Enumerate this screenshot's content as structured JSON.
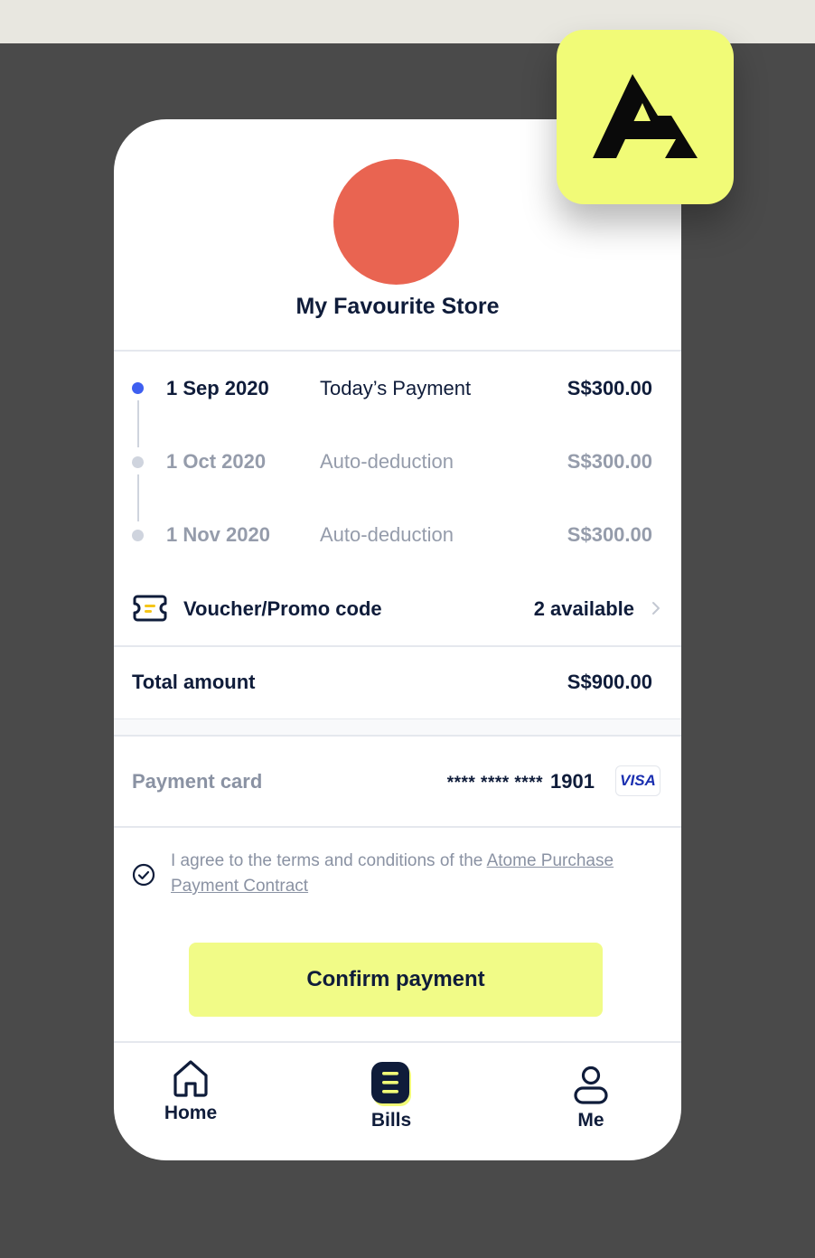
{
  "brand": {
    "logo_icon": "atome-logo-icon",
    "accent_color": "#f1fb77"
  },
  "merchant": {
    "name": "My Favourite Store",
    "logo_color": "#e96451"
  },
  "schedule": [
    {
      "date": "1 Sep 2020",
      "label": "Today’s Payment",
      "amount": "S$300.00",
      "state": "current"
    },
    {
      "date": "1 Oct 2020",
      "label": "Auto-deduction",
      "amount": "S$300.00",
      "state": "upcoming"
    },
    {
      "date": "1 Nov 2020",
      "label": "Auto-deduction",
      "amount": "S$300.00",
      "state": "upcoming"
    }
  ],
  "voucher": {
    "icon": "voucher-ticket-icon",
    "label": "Voucher/Promo code",
    "count_text": "2 available"
  },
  "total": {
    "label": "Total amount",
    "amount": "S$900.00"
  },
  "payment_card": {
    "label": "Payment card",
    "masked": "**** **** ****",
    "last4": "1901",
    "network": "VISA"
  },
  "terms": {
    "text": "I agree to the terms and conditions of the ",
    "link_text": "Atome Purchase Payment Contract",
    "checked": true
  },
  "confirm_button": {
    "label": "Confirm payment"
  },
  "bottom_nav": {
    "items": [
      {
        "label": "Home",
        "icon": "home-icon",
        "active": false
      },
      {
        "label": "Bills",
        "icon": "bills-icon",
        "active": true
      },
      {
        "label": "Me",
        "icon": "profile-icon",
        "active": false
      }
    ]
  }
}
